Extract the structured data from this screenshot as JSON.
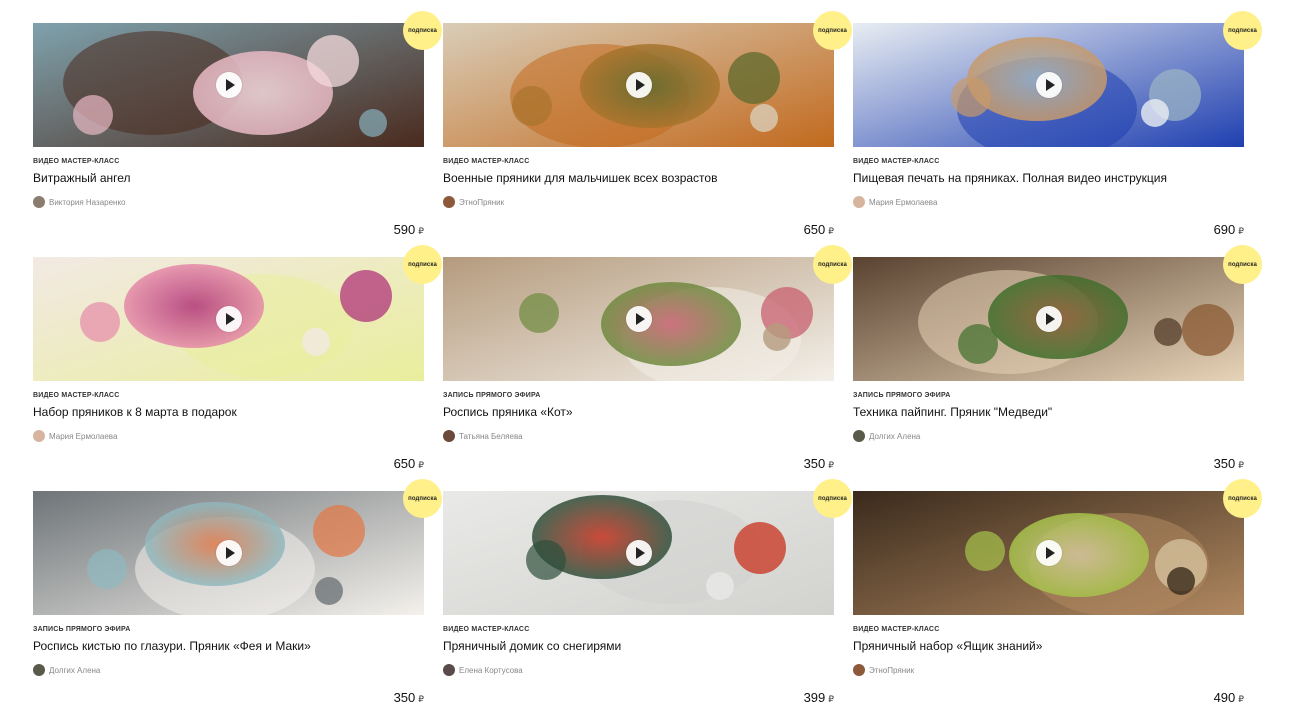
{
  "catalog": {
    "badge_label": "подписка",
    "currency_symbol": "₽",
    "cards": [
      {
        "type": "Видео мастер-класс",
        "title": "Витражный ангел",
        "author": "Виктория Назаренко",
        "price": "590",
        "palette": [
          "#7fa2ad",
          "#4a2a1e",
          "#f3d9dc",
          "#e9b9c4"
        ],
        "avatar_color": "#8a7d70"
      },
      {
        "type": "Видео мастер-класс",
        "title": "Военные пряники для мальчишек всех возрастов",
        "author": "ЭтноПряник",
        "price": "650",
        "palette": [
          "#d9cdb8",
          "#c26a1e",
          "#5e6a2e",
          "#a8742c"
        ],
        "avatar_color": "#8c5a3a"
      },
      {
        "type": "Видео мастер-класс",
        "title": "Пищевая печать на пряниках. Полная видео инструкция",
        "author": "Мария Ермолаева",
        "price": "690",
        "palette": [
          "#e8edf2",
          "#1f3fb0",
          "#9bb3c4",
          "#c79a6a"
        ],
        "avatar_color": "#d7b49e"
      },
      {
        "type": "Видео мастер-класс",
        "title": "Набор пряников к 8 марта в подарок",
        "author": "Мария Ермолаева",
        "price": "650",
        "palette": [
          "#f2e9e4",
          "#e9ee9c",
          "#b0347a",
          "#e58aa8"
        ],
        "avatar_color": "#d7b49e"
      },
      {
        "type": "Запись прямого эфира",
        "title": "Роспись пряника «Кот»",
        "author": "Татьяна Беляева",
        "price": "350",
        "palette": [
          "#b59b7e",
          "#f3efe8",
          "#c86070",
          "#6e8a3e"
        ],
        "avatar_color": "#6b4a3a"
      },
      {
        "type": "Запись прямого эфира",
        "title": "Техника пайпинг. Пряник \"Медведи\"",
        "author": "Долгих Алена",
        "price": "350",
        "palette": [
          "#5a4230",
          "#e7d4b8",
          "#8a5a32",
          "#3f6e2a"
        ],
        "avatar_color": "#5a5a4a"
      },
      {
        "type": "Запись прямого эфира",
        "title": "Роспись кистью по глазури. Пряник «Фея и Маки»",
        "author": "Долгих Алена",
        "price": "350",
        "palette": [
          "#6e7478",
          "#f4f1ec",
          "#e07a4a",
          "#8fb9c0"
        ],
        "avatar_color": "#5a5a4a"
      },
      {
        "type": "Видео мастер-класс",
        "title": "Пряничный домик со снегирями",
        "author": "Елена Кортусова",
        "price": "399",
        "palette": [
          "#e9e9e7",
          "#d2d2cf",
          "#c8321e",
          "#2f4f3a"
        ],
        "avatar_color": "#5a4a4a"
      },
      {
        "type": "Видео мастер-класс",
        "title": "Пряничный набор «Ящик знаний»",
        "author": "ЭтноПряник",
        "price": "490",
        "palette": [
          "#3a2a1c",
          "#b08860",
          "#d7c6a0",
          "#a7c34a"
        ],
        "avatar_color": "#8c5a3a"
      }
    ]
  }
}
